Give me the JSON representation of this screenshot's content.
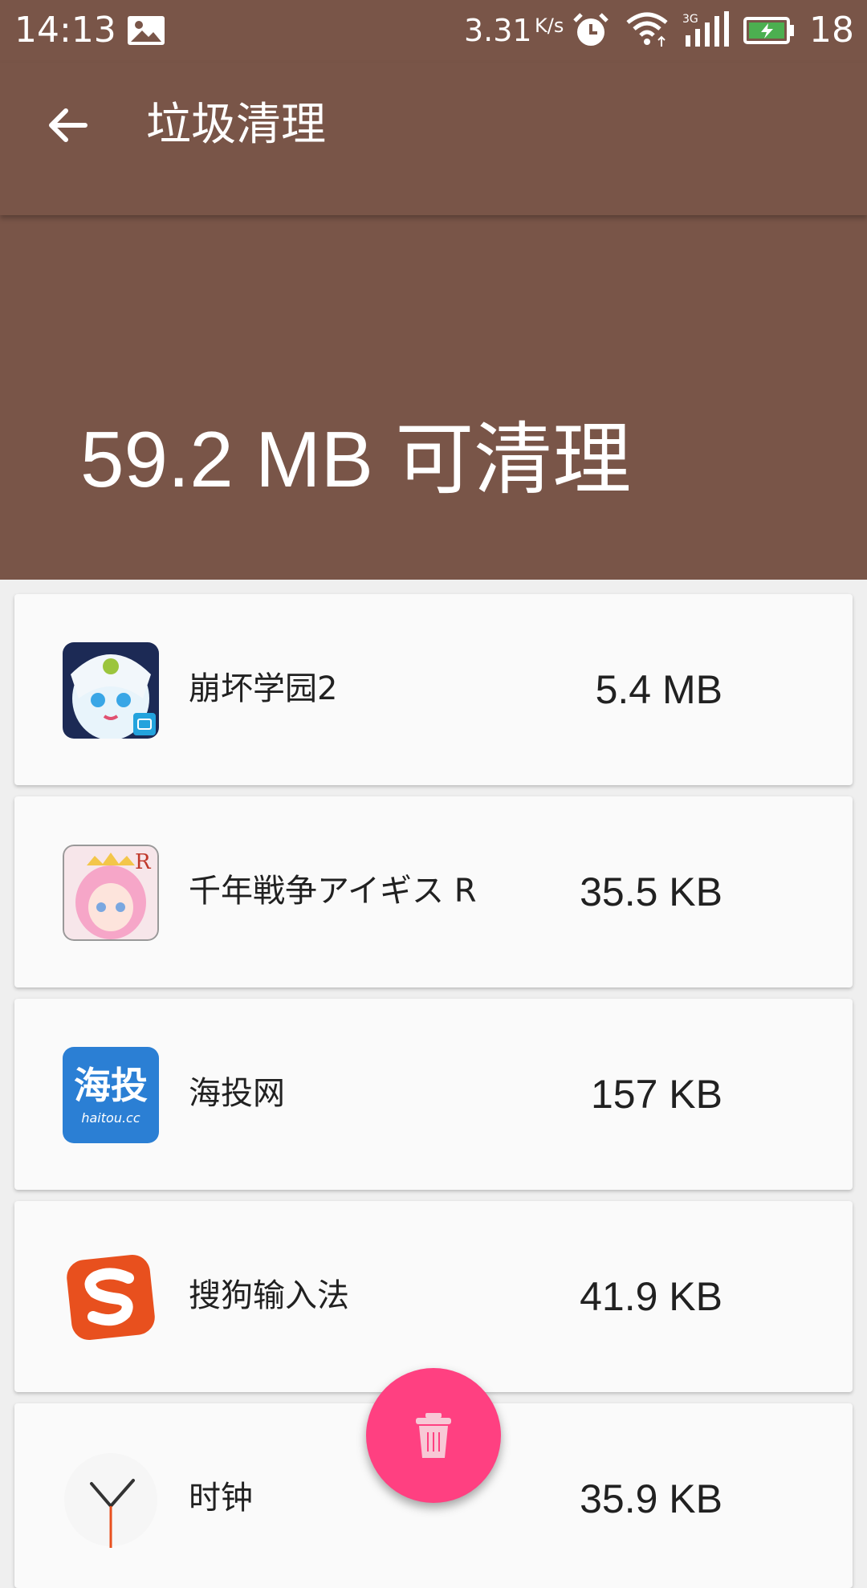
{
  "status_bar": {
    "time": "14:13",
    "net_speed": "3.31",
    "net_speed_unit": "K/s",
    "battery_level": "18",
    "icons": [
      "gallery-icon",
      "alarm-icon",
      "wifi-icon",
      "signal-3g-icon",
      "battery-charging-icon"
    ]
  },
  "toolbar": {
    "title": "垃圾清理",
    "back_icon": "arrow-back-icon"
  },
  "summary": {
    "text": "59.2 MB 可清理"
  },
  "apps": [
    {
      "name": "崩坏学园2",
      "size": "5.4 MB",
      "icon": "honkai-gakuen-app-icon"
    },
    {
      "name": "千年戦争アイギス R",
      "size": "35.5 KB",
      "icon": "aigis-app-icon"
    },
    {
      "name": "海投网",
      "size": "157 KB",
      "icon": "haitou-app-icon",
      "icon_text": "海投",
      "icon_subtext": "haitou.cc"
    },
    {
      "name": "搜狗输入法",
      "size": "41.9 KB",
      "icon": "sogou-app-icon"
    },
    {
      "name": "时钟",
      "size": "35.9 KB",
      "icon": "clock-app-icon"
    }
  ],
  "fab": {
    "icon": "trash-icon"
  },
  "colors": {
    "primary": "#795548",
    "accent": "#ff4081",
    "card": "#fafafa",
    "background": "#efefef"
  }
}
